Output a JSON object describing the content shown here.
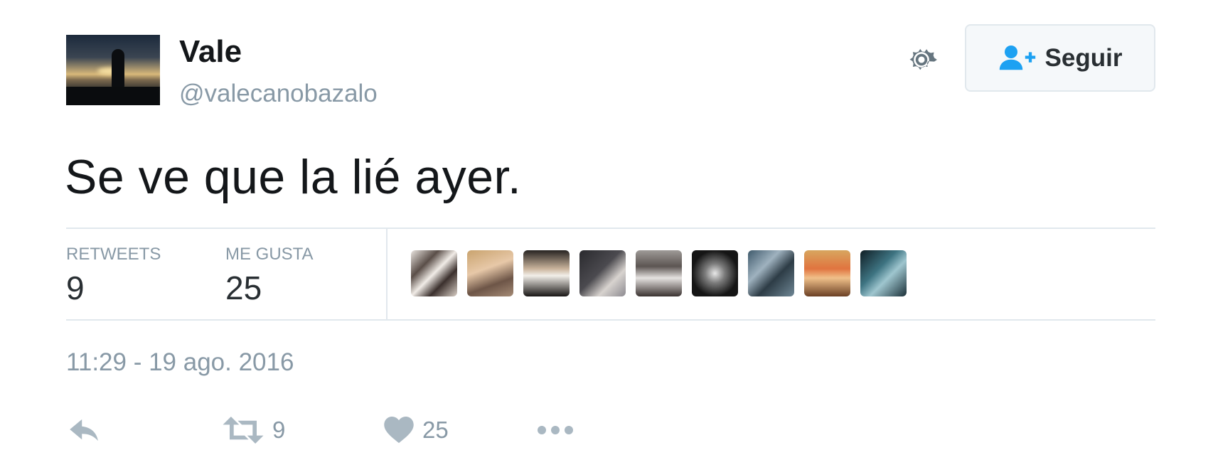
{
  "user": {
    "name": "Vale",
    "handle": "@valecanobazalo",
    "avatar_icon": "avatar-photo"
  },
  "header": {
    "settings_icon": "gear-icon",
    "follow_label": "Seguir",
    "follow_icon": "follow-user-icon"
  },
  "tweet": {
    "text": "Se ve que la lié ayer."
  },
  "stats": {
    "retweets_label": "RETWEETS",
    "retweets_value": "9",
    "likes_label": "ME GUSTA",
    "likes_value": "25"
  },
  "likers": [
    {
      "icon": "liker-avatar"
    },
    {
      "icon": "liker-avatar"
    },
    {
      "icon": "liker-avatar"
    },
    {
      "icon": "liker-avatar"
    },
    {
      "icon": "liker-avatar"
    },
    {
      "icon": "liker-avatar"
    },
    {
      "icon": "liker-avatar"
    },
    {
      "icon": "liker-avatar"
    },
    {
      "icon": "liker-avatar"
    }
  ],
  "timestamp": "11:29 - 19 ago. 2016",
  "actions": {
    "reply_icon": "reply-icon",
    "retweet_icon": "retweet-icon",
    "retweet_count": "9",
    "like_icon": "heart-icon",
    "like_count": "25",
    "more_icon": "more-icon"
  },
  "colors": {
    "accent": "#1da1f2",
    "muted": "#8899a6",
    "text": "#292f33",
    "divider": "#e1e8ed"
  }
}
